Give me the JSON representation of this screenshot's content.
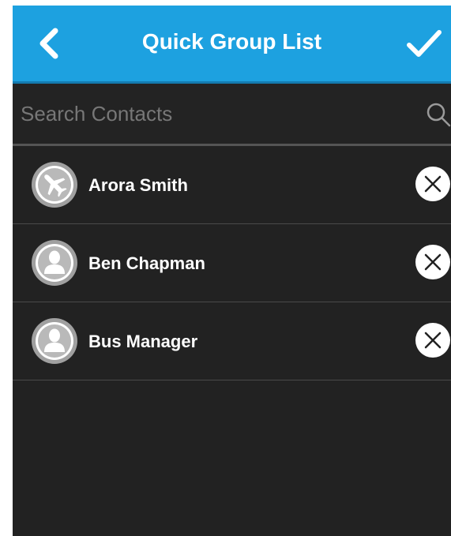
{
  "header": {
    "title": "Quick Group List",
    "back_icon": "chevron-left-icon",
    "confirm_icon": "checkmark-icon"
  },
  "search": {
    "placeholder": "Search Contacts",
    "value": "",
    "icon": "search-icon"
  },
  "contacts": [
    {
      "name": "Arora Smith",
      "avatar_icon": "airplane-icon"
    },
    {
      "name": "Ben Chapman",
      "avatar_icon": "person-icon"
    },
    {
      "name": "Bus Manager",
      "avatar_icon": "person-icon"
    }
  ],
  "colors": {
    "header_bg": "#1da1e0",
    "screen_bg": "#222222",
    "text": "#ffffff",
    "avatar_ring": "#a0a0a0",
    "avatar_fill": "#bdbdbd"
  }
}
